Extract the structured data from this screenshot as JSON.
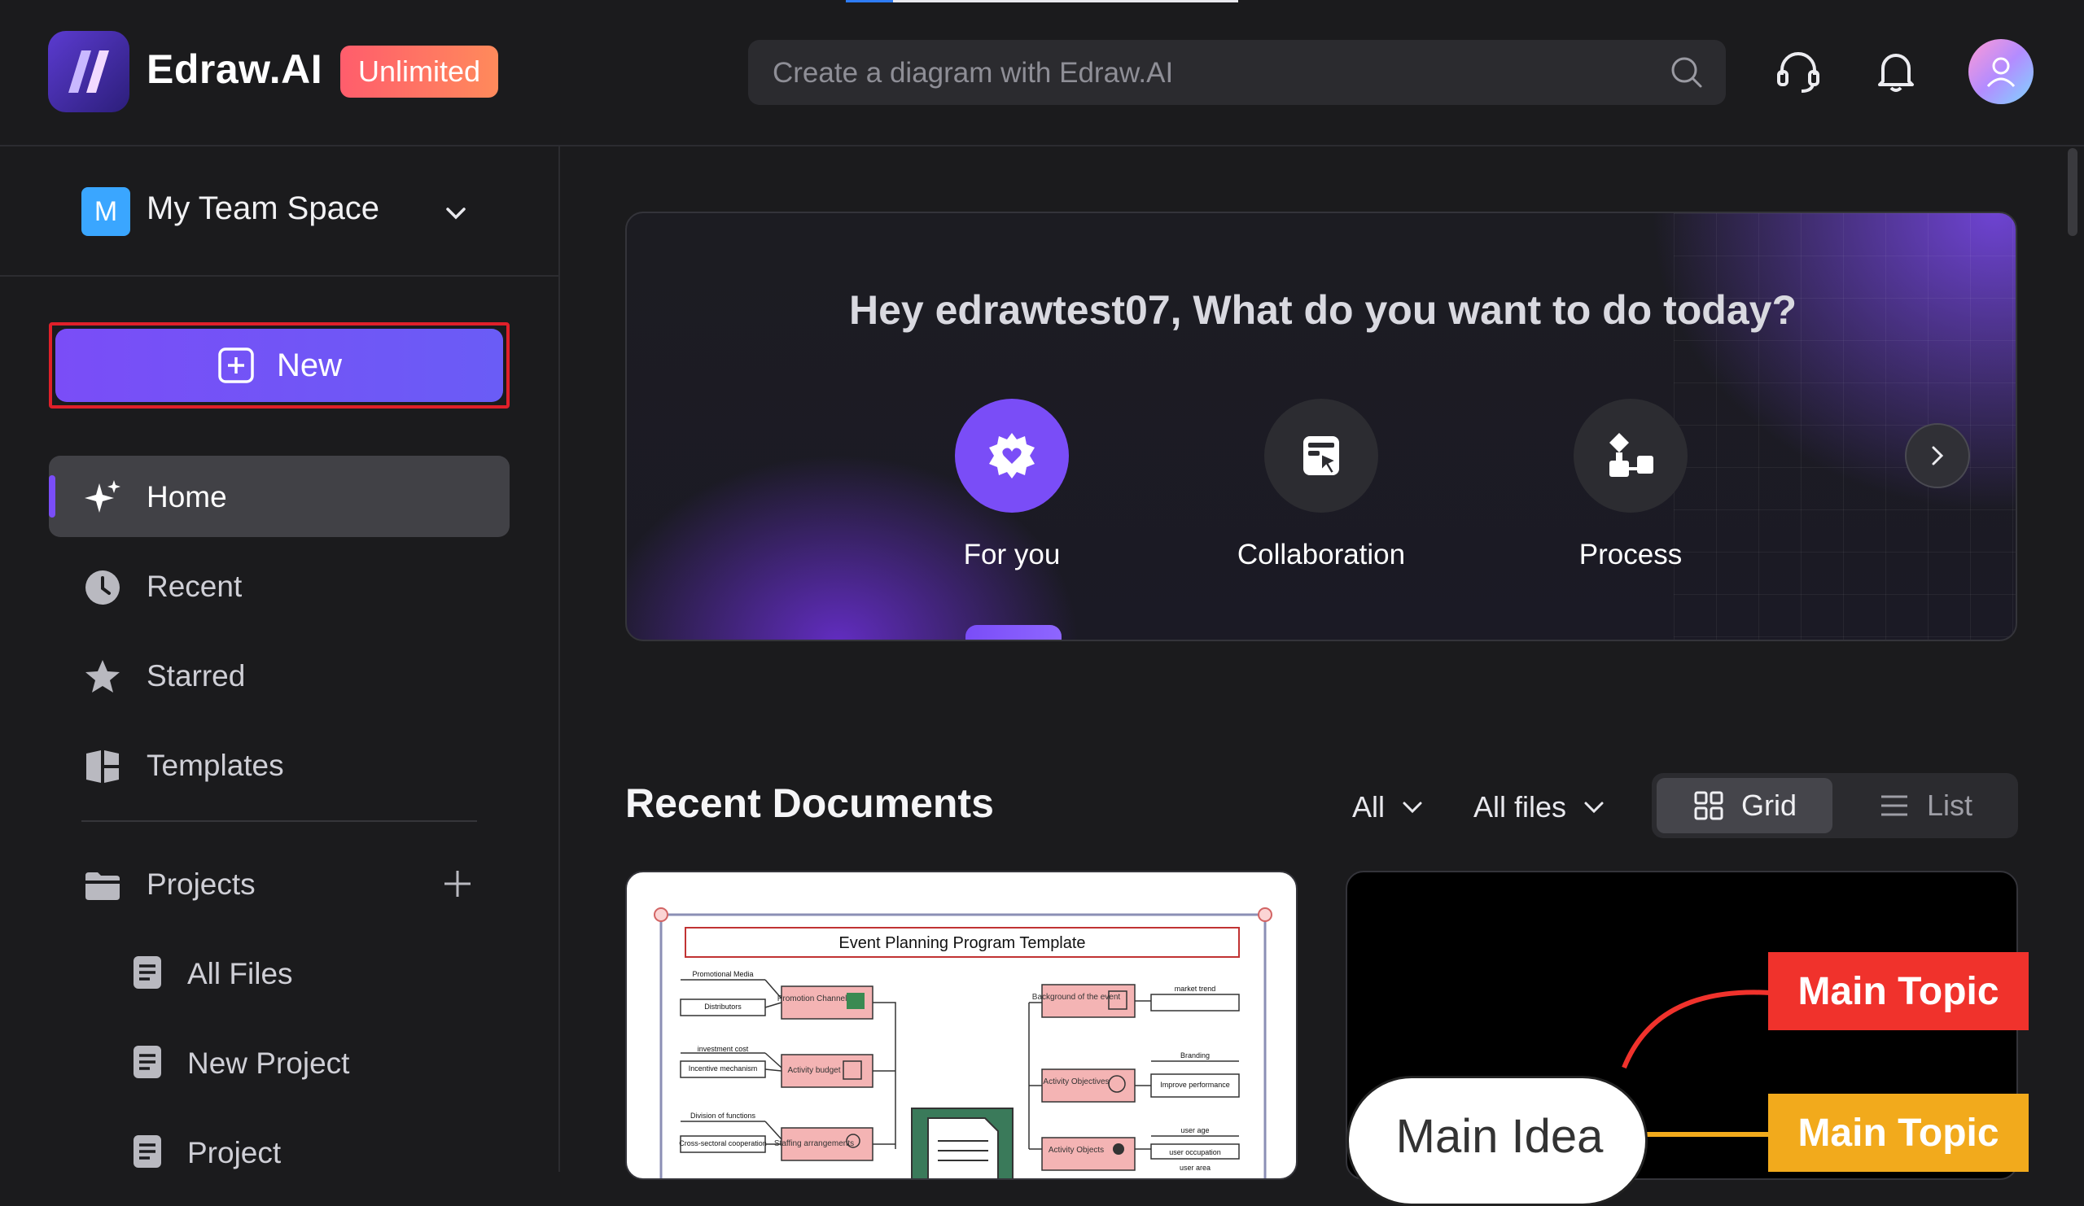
{
  "header": {
    "progress_fraction": 0.12,
    "app_name": "Edraw.AI",
    "plan_badge": "Unlimited",
    "search_placeholder": "Create a diagram with Edraw.AI",
    "icons": [
      "search-icon",
      "headset-icon",
      "bell-icon",
      "avatar"
    ]
  },
  "sidebar": {
    "team_badge": "M",
    "team_name": "My Team Space",
    "new_button": "New",
    "nav": [
      {
        "label": "Home",
        "icon": "sparkle-icon",
        "active": true
      },
      {
        "label": "Recent",
        "icon": "clock-icon"
      },
      {
        "label": "Starred",
        "icon": "star-icon"
      },
      {
        "label": "Templates",
        "icon": "templates-icon"
      }
    ],
    "projects_label": "Projects",
    "project_items": [
      "All Files",
      "New Project",
      "Project"
    ]
  },
  "hero": {
    "title": "Hey edrawtest07, What do you want to do today?",
    "actions": [
      {
        "label": "For you",
        "icon": "gear-heart-icon",
        "active": true
      },
      {
        "label": "Collaboration",
        "icon": "collaboration-icon"
      },
      {
        "label": "Process",
        "icon": "process-icon"
      }
    ]
  },
  "recent": {
    "title": "Recent Documents",
    "filter_all": "All",
    "filter_files": "All files",
    "view_grid": "Grid",
    "view_list": "List"
  },
  "cards": {
    "event_template": {
      "title": "Event Planning Program Template",
      "left_labels": [
        "Promotional Media",
        "Distributors",
        "investment cost",
        "Incentive mechanism",
        "Division of functions",
        "Cross-sectoral cooperation"
      ],
      "left_boxes": [
        "Promotion Channels",
        "Activity budget",
        "Staffing arrangements"
      ],
      "right_boxes": [
        "Background of the event",
        "Activity Objectives",
        "Activity Objects"
      ],
      "right_labels": [
        "market trend",
        "Branding",
        "Improve performance",
        "user age",
        "user occupation",
        "user area"
      ]
    },
    "mind_map": {
      "main_idea": "Main Idea",
      "topics": [
        "Main Topic",
        "Main Topic"
      ],
      "topic_colors": [
        "#f0322c",
        "#f2aa1c"
      ]
    }
  },
  "colors": {
    "accent": "#7a4df7",
    "background": "#1b1b1d",
    "highlight_border": "#e0202a"
  }
}
